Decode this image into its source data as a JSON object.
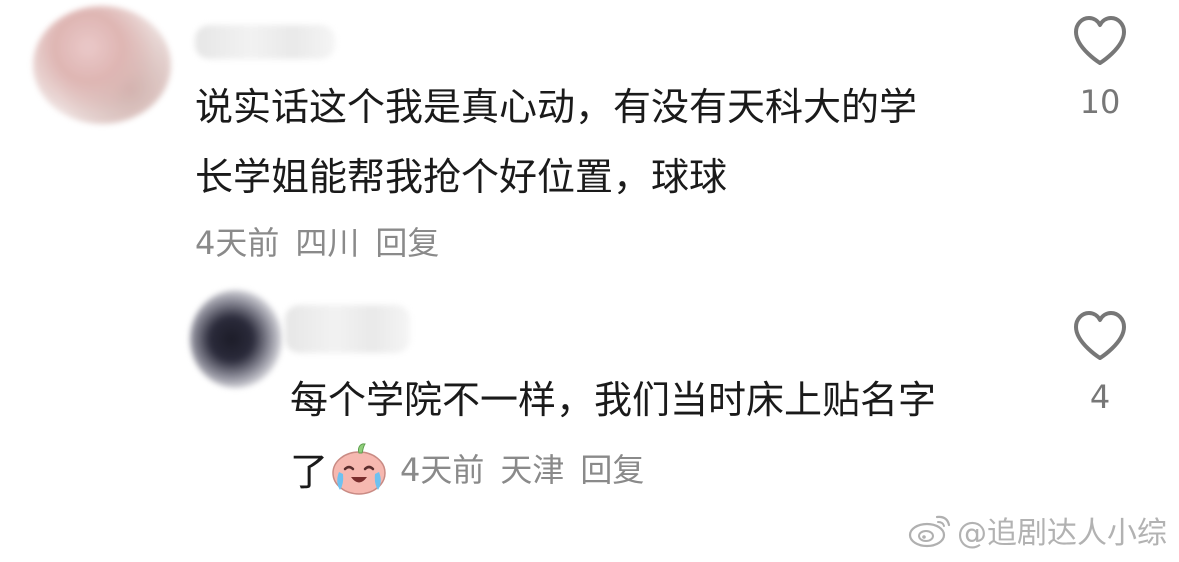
{
  "comments": [
    {
      "text": "说实话这个我是真心动，有没有天科大的学\n长学姐能帮我抢个好位置，球球",
      "time": "4天前",
      "location": "四川",
      "reply_label": "回复",
      "likes": "10"
    },
    {
      "text": "每个学院不一样，我们当时床上贴名字",
      "text_tail": "了",
      "emoji": "cry-laugh-emoji",
      "time": "4天前",
      "location": "天津",
      "reply_label": "回复",
      "likes": "4"
    }
  ],
  "watermark": {
    "text": "@追剧达人小综",
    "icon": "weibo-icon"
  },
  "colors": {
    "text": "#1a1a1a",
    "meta": "#8a8a8a",
    "like_icon": "#777777"
  }
}
